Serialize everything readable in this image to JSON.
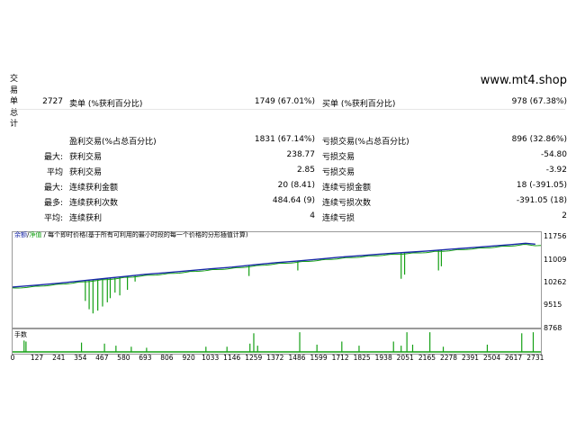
{
  "side_label": [
    "交",
    "易",
    "单",
    "总",
    "计"
  ],
  "site": "www.mt4.shop",
  "stats": {
    "total": "2727",
    "short_label": "卖单 (%获利百分比)",
    "short_value": "1749 (67.01%)",
    "long_label": "买单 (%获利百分比)",
    "long_value": "978 (67.38%)",
    "profit_trades_label": "盈利交易(%占总百分比)",
    "profit_trades_value": "1831 (67.14%)",
    "loss_trades_label": "亏损交易(%占总百分比)",
    "loss_trades_value": "896 (32.86%)",
    "max_label": "最大:",
    "max_profit_label": "获利交易",
    "max_profit_value": "238.77",
    "max_loss_label": "亏损交易",
    "max_loss_value": "-54.80",
    "avg_label": "平均",
    "avg_profit_label": "获利交易",
    "avg_profit_value": "2.85",
    "avg_loss_label": "亏损交易",
    "avg_loss_value": "-3.92",
    "max2_label": "最大:",
    "cons_wins_amt_label": "连续获利金额",
    "cons_wins_amt_value": "20 (8.41)",
    "cons_loss_amt_label": "连续亏损金额",
    "cons_loss_amt_value": "18 (-391.05)",
    "most_label": "最多:",
    "cons_profit_cnt_label": "连续获利次数",
    "cons_profit_cnt_value": "484.64 (9)",
    "cons_loss_cnt_label": "连续亏损次数",
    "cons_loss_cnt_value": "-391.05 (18)",
    "avg2_label": "平均:",
    "avg_cons_wins_label": "连续获利",
    "avg_cons_wins_value": "4",
    "avg_cons_loss_label": "连续亏损",
    "avg_cons_loss_value": "2"
  },
  "chart_legend": {
    "balance": "余额",
    "sep": "/",
    "equity": "净值",
    "rest": " / 每个即时价格(基于所有可利用的最小时段的每一个价格的分形插值计算)"
  },
  "chart_data": {
    "type": "line",
    "colors": {
      "balance": "#1a2aa8",
      "equity": "#15a015",
      "volume": "#15a015"
    },
    "y_ticks": [
      "11756",
      "11009",
      "10262",
      "9515",
      "8768"
    ],
    "ylim": [
      8768,
      11756
    ],
    "x_ticks": [
      "0",
      "127",
      "241",
      "354",
      "467",
      "580",
      "693",
      "806",
      "920",
      "1033",
      "1146",
      "1259",
      "1372",
      "1486",
      "1599",
      "1712",
      "1825",
      "1938",
      "2051",
      "2165",
      "2278",
      "2391",
      "2504",
      "2617",
      "2731"
    ],
    "xlim": [
      0,
      2760
    ],
    "balance": [
      [
        0,
        10100
      ],
      [
        127,
        10170
      ],
      [
        241,
        10240
      ],
      [
        354,
        10320
      ],
      [
        467,
        10400
      ],
      [
        580,
        10480
      ],
      [
        693,
        10560
      ],
      [
        806,
        10620
      ],
      [
        920,
        10690
      ],
      [
        1033,
        10760
      ],
      [
        1146,
        10820
      ],
      [
        1259,
        10900
      ],
      [
        1372,
        10980
      ],
      [
        1486,
        11040
      ],
      [
        1599,
        11110
      ],
      [
        1712,
        11180
      ],
      [
        1825,
        11240
      ],
      [
        1938,
        11300
      ],
      [
        2051,
        11350
      ],
      [
        2165,
        11400
      ],
      [
        2278,
        11460
      ],
      [
        2391,
        11520
      ],
      [
        2504,
        11580
      ],
      [
        2617,
        11640
      ],
      [
        2680,
        11680
      ],
      [
        2731,
        11650
      ]
    ],
    "equity_dips": [
      [
        380,
        9600
      ],
      [
        400,
        9300
      ],
      [
        420,
        9150
      ],
      [
        445,
        9250
      ],
      [
        470,
        9400
      ],
      [
        495,
        9550
      ],
      [
        510,
        9700
      ],
      [
        535,
        9900
      ],
      [
        560,
        9800
      ],
      [
        600,
        10000
      ],
      [
        640,
        10300
      ],
      [
        1235,
        10500
      ],
      [
        1490,
        10700
      ],
      [
        2030,
        10400
      ],
      [
        2048,
        10550
      ],
      [
        2225,
        10700
      ],
      [
        2240,
        10850
      ]
    ],
    "sub_label": "手数",
    "volume_spikes": [
      [
        60,
        0.55
      ],
      [
        70,
        0.5
      ],
      [
        360,
        0.45
      ],
      [
        480,
        0.4
      ],
      [
        540,
        0.3
      ],
      [
        620,
        0.25
      ],
      [
        700,
        0.2
      ],
      [
        1010,
        0.25
      ],
      [
        1120,
        0.25
      ],
      [
        1240,
        0.4
      ],
      [
        1260,
        0.9
      ],
      [
        1280,
        0.3
      ],
      [
        1500,
        0.95
      ],
      [
        1590,
        0.35
      ],
      [
        1720,
        0.5
      ],
      [
        1810,
        0.3
      ],
      [
        1990,
        0.5
      ],
      [
        2030,
        0.3
      ],
      [
        2060,
        0.95
      ],
      [
        2090,
        0.35
      ],
      [
        2180,
        0.95
      ],
      [
        2250,
        0.25
      ],
      [
        2480,
        0.35
      ],
      [
        2660,
        0.9
      ],
      [
        2720,
        0.95
      ]
    ]
  }
}
